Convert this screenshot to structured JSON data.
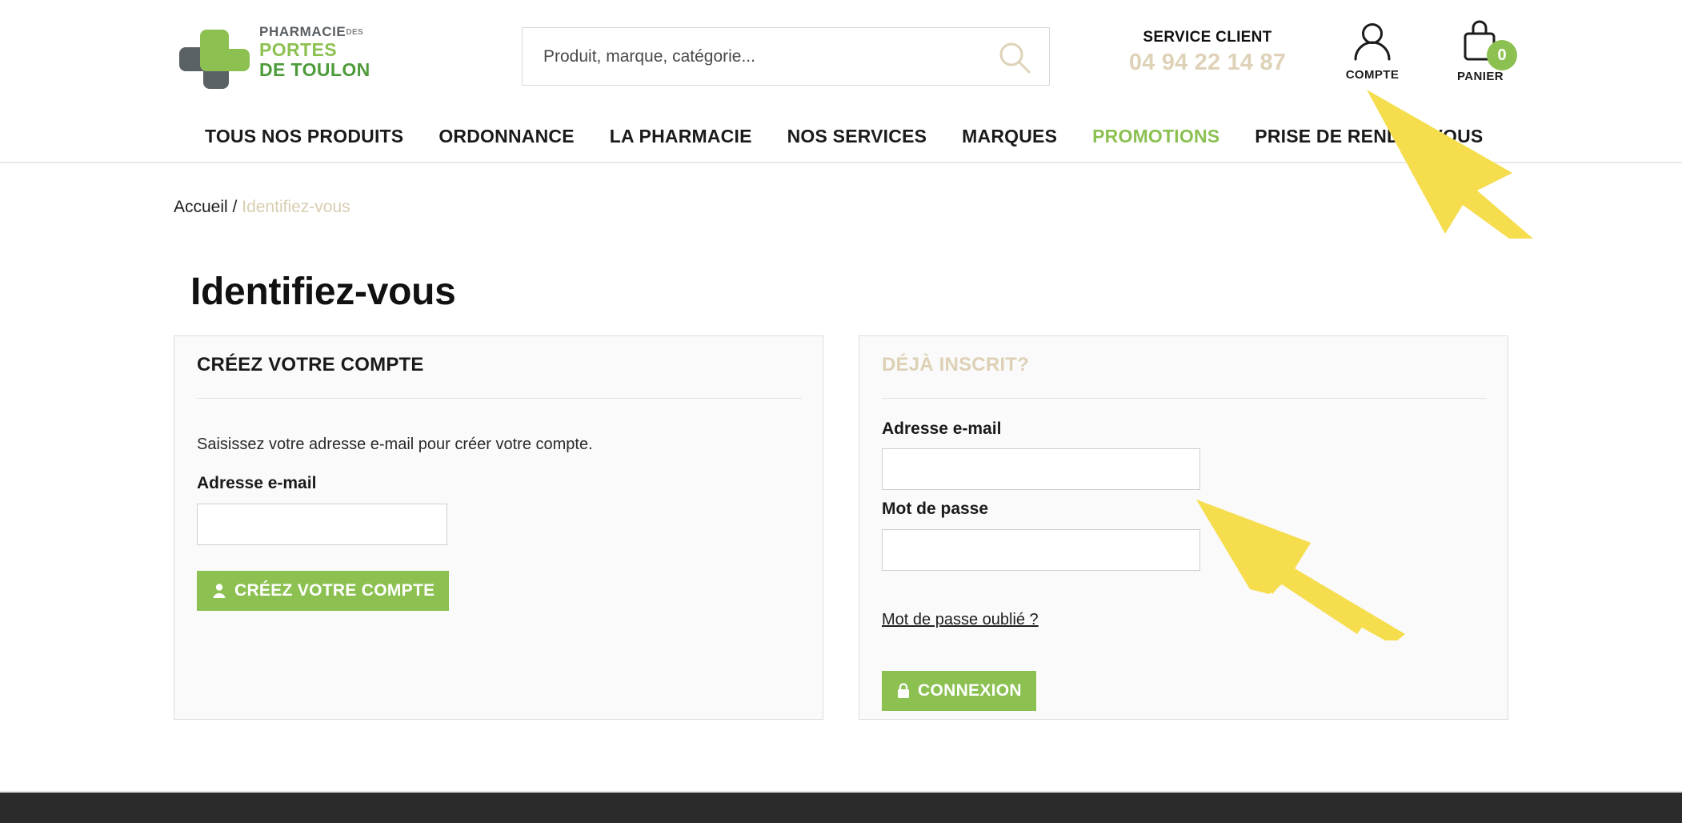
{
  "brand": {
    "logo_line1": "PHARMACIE",
    "logo_line1_suffix": "DES",
    "logo_line2": "PORTES",
    "logo_line3": "DE TOULON",
    "green_light": "#8cc152",
    "green_dark": "#4e9b3c",
    "beige": "#ded3b8",
    "arrow_yellow": "#F5DD4D"
  },
  "header": {
    "search_placeholder": "Produit, marque, catégorie...",
    "search_value": "",
    "search_icon": "search-icon",
    "service_title": "SERVICE CLIENT",
    "service_phone": "04 94 22 14 87",
    "account_label": "COMPTE",
    "account_icon": "user-icon",
    "cart_label": "PANIER",
    "cart_icon": "shopping-bag-icon",
    "cart_count": "0"
  },
  "nav": {
    "items": [
      {
        "label": "TOUS NOS PRODUITS",
        "highlight": false
      },
      {
        "label": "ORDONNANCE",
        "highlight": false
      },
      {
        "label": "LA PHARMACIE",
        "highlight": false
      },
      {
        "label": "NOS SERVICES",
        "highlight": false
      },
      {
        "label": "MARQUES",
        "highlight": false
      },
      {
        "label": "PROMOTIONS",
        "highlight": true
      },
      {
        "label": "PRISE DE RENDEZ-VOUS",
        "highlight": false
      }
    ]
  },
  "breadcrumb": {
    "home": "Accueil",
    "separator": "/",
    "current": "Identifiez-vous"
  },
  "page": {
    "title": "Identifiez-vous"
  },
  "create_account": {
    "title": "CRÉEZ VOTRE COMPTE",
    "description": "Saisissez votre adresse e-mail pour créer votre compte.",
    "email_label": "Adresse e-mail",
    "email_value": "",
    "email_placeholder": "",
    "button_label": "CRÉEZ VOTRE COMPTE",
    "button_icon": "user-icon"
  },
  "login": {
    "title": "DÉJÀ INSCRIT?",
    "email_label": "Adresse e-mail",
    "email_value": "",
    "email_placeholder": "",
    "password_label": "Mot de passe",
    "password_value": "",
    "password_placeholder": "",
    "forgot_label": "Mot de passe oublié ?",
    "button_label": "CONNEXION",
    "button_icon": "lock-icon"
  },
  "annotations": {
    "arrow_top": "arrow-cursor-pointing-to-compte",
    "arrow_bottom": "arrow-cursor-pointing-to-password-field"
  }
}
